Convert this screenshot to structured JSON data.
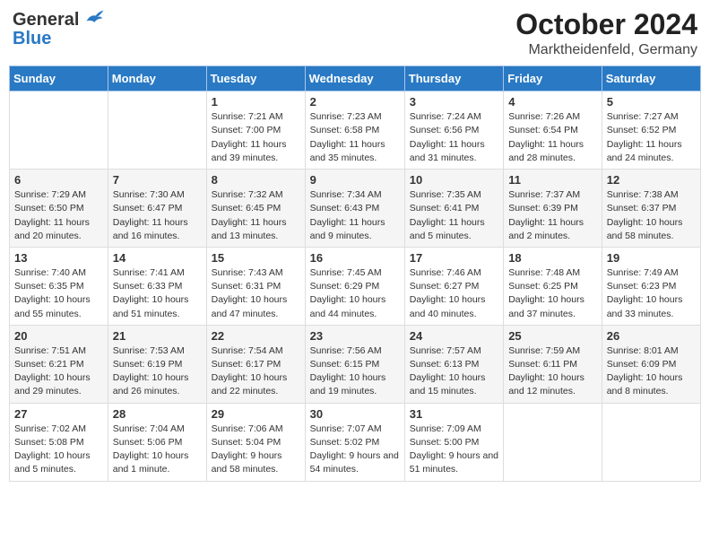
{
  "header": {
    "logo_general": "General",
    "logo_blue": "Blue",
    "month_title": "October 2024",
    "location": "Marktheidenfeld, Germany"
  },
  "weekdays": [
    "Sunday",
    "Monday",
    "Tuesday",
    "Wednesday",
    "Thursday",
    "Friday",
    "Saturday"
  ],
  "weeks": [
    [
      {
        "day": "",
        "info": ""
      },
      {
        "day": "",
        "info": ""
      },
      {
        "day": "1",
        "info": "Sunrise: 7:21 AM\nSunset: 7:00 PM\nDaylight: 11 hours and 39 minutes."
      },
      {
        "day": "2",
        "info": "Sunrise: 7:23 AM\nSunset: 6:58 PM\nDaylight: 11 hours and 35 minutes."
      },
      {
        "day": "3",
        "info": "Sunrise: 7:24 AM\nSunset: 6:56 PM\nDaylight: 11 hours and 31 minutes."
      },
      {
        "day": "4",
        "info": "Sunrise: 7:26 AM\nSunset: 6:54 PM\nDaylight: 11 hours and 28 minutes."
      },
      {
        "day": "5",
        "info": "Sunrise: 7:27 AM\nSunset: 6:52 PM\nDaylight: 11 hours and 24 minutes."
      }
    ],
    [
      {
        "day": "6",
        "info": "Sunrise: 7:29 AM\nSunset: 6:50 PM\nDaylight: 11 hours and 20 minutes."
      },
      {
        "day": "7",
        "info": "Sunrise: 7:30 AM\nSunset: 6:47 PM\nDaylight: 11 hours and 16 minutes."
      },
      {
        "day": "8",
        "info": "Sunrise: 7:32 AM\nSunset: 6:45 PM\nDaylight: 11 hours and 13 minutes."
      },
      {
        "day": "9",
        "info": "Sunrise: 7:34 AM\nSunset: 6:43 PM\nDaylight: 11 hours and 9 minutes."
      },
      {
        "day": "10",
        "info": "Sunrise: 7:35 AM\nSunset: 6:41 PM\nDaylight: 11 hours and 5 minutes."
      },
      {
        "day": "11",
        "info": "Sunrise: 7:37 AM\nSunset: 6:39 PM\nDaylight: 11 hours and 2 minutes."
      },
      {
        "day": "12",
        "info": "Sunrise: 7:38 AM\nSunset: 6:37 PM\nDaylight: 10 hours and 58 minutes."
      }
    ],
    [
      {
        "day": "13",
        "info": "Sunrise: 7:40 AM\nSunset: 6:35 PM\nDaylight: 10 hours and 55 minutes."
      },
      {
        "day": "14",
        "info": "Sunrise: 7:41 AM\nSunset: 6:33 PM\nDaylight: 10 hours and 51 minutes."
      },
      {
        "day": "15",
        "info": "Sunrise: 7:43 AM\nSunset: 6:31 PM\nDaylight: 10 hours and 47 minutes."
      },
      {
        "day": "16",
        "info": "Sunrise: 7:45 AM\nSunset: 6:29 PM\nDaylight: 10 hours and 44 minutes."
      },
      {
        "day": "17",
        "info": "Sunrise: 7:46 AM\nSunset: 6:27 PM\nDaylight: 10 hours and 40 minutes."
      },
      {
        "day": "18",
        "info": "Sunrise: 7:48 AM\nSunset: 6:25 PM\nDaylight: 10 hours and 37 minutes."
      },
      {
        "day": "19",
        "info": "Sunrise: 7:49 AM\nSunset: 6:23 PM\nDaylight: 10 hours and 33 minutes."
      }
    ],
    [
      {
        "day": "20",
        "info": "Sunrise: 7:51 AM\nSunset: 6:21 PM\nDaylight: 10 hours and 29 minutes."
      },
      {
        "day": "21",
        "info": "Sunrise: 7:53 AM\nSunset: 6:19 PM\nDaylight: 10 hours and 26 minutes."
      },
      {
        "day": "22",
        "info": "Sunrise: 7:54 AM\nSunset: 6:17 PM\nDaylight: 10 hours and 22 minutes."
      },
      {
        "day": "23",
        "info": "Sunrise: 7:56 AM\nSunset: 6:15 PM\nDaylight: 10 hours and 19 minutes."
      },
      {
        "day": "24",
        "info": "Sunrise: 7:57 AM\nSunset: 6:13 PM\nDaylight: 10 hours and 15 minutes."
      },
      {
        "day": "25",
        "info": "Sunrise: 7:59 AM\nSunset: 6:11 PM\nDaylight: 10 hours and 12 minutes."
      },
      {
        "day": "26",
        "info": "Sunrise: 8:01 AM\nSunset: 6:09 PM\nDaylight: 10 hours and 8 minutes."
      }
    ],
    [
      {
        "day": "27",
        "info": "Sunrise: 7:02 AM\nSunset: 5:08 PM\nDaylight: 10 hours and 5 minutes."
      },
      {
        "day": "28",
        "info": "Sunrise: 7:04 AM\nSunset: 5:06 PM\nDaylight: 10 hours and 1 minute."
      },
      {
        "day": "29",
        "info": "Sunrise: 7:06 AM\nSunset: 5:04 PM\nDaylight: 9 hours and 58 minutes."
      },
      {
        "day": "30",
        "info": "Sunrise: 7:07 AM\nSunset: 5:02 PM\nDaylight: 9 hours and 54 minutes."
      },
      {
        "day": "31",
        "info": "Sunrise: 7:09 AM\nSunset: 5:00 PM\nDaylight: 9 hours and 51 minutes."
      },
      {
        "day": "",
        "info": ""
      },
      {
        "day": "",
        "info": ""
      }
    ]
  ]
}
